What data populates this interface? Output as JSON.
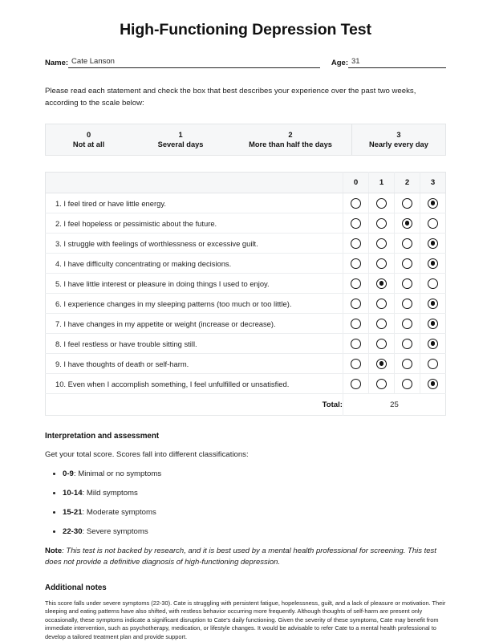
{
  "document": {
    "title": "High-Functioning Depression Test"
  },
  "patient": {
    "name_label": "Name:",
    "name_value": "Cate Lanson",
    "age_label": "Age:",
    "age_value": "31"
  },
  "instructions": {
    "text": "Please read each statement and check the box that best describes your experience over the past two weeks, according to the scale below:"
  },
  "scale": {
    "items": [
      {
        "num": "0",
        "label": "Not at all"
      },
      {
        "num": "1",
        "label": "Several days"
      },
      {
        "num": "2",
        "label": "More than half the days"
      },
      {
        "num": "3",
        "label": "Nearly every day"
      }
    ]
  },
  "questionnaire": {
    "question_header": "",
    "answer_headers": [
      "0",
      "1",
      "2",
      "3"
    ],
    "rows": [
      {
        "text": "1. I feel tired or have little energy.",
        "selected": 3
      },
      {
        "text": "2. I feel hopeless or pessimistic about the future.",
        "selected": 2
      },
      {
        "text": "3. I struggle with feelings of worthlessness or excessive guilt.",
        "selected": 3
      },
      {
        "text": "4. I have difficulty concentrating or making decisions.",
        "selected": 3
      },
      {
        "text": "5. I have little interest or pleasure in doing things I used to enjoy.",
        "selected": 1
      },
      {
        "text": "6. I experience changes in my sleeping patterns (too much or too little).",
        "selected": 3
      },
      {
        "text": "7. I have changes in my appetite or weight (increase or decrease).",
        "selected": 3
      },
      {
        "text": "8. I feel restless or have trouble sitting still.",
        "selected": 3
      },
      {
        "text": "9. I have thoughts of death or self-harm.",
        "selected": 1
      },
      {
        "text": "10. Even when I accomplish something, I feel unfulfilled or unsatisfied.",
        "selected": 3
      }
    ],
    "total_label": "Total:",
    "total_value": "25"
  },
  "interpretation": {
    "heading": "Interpretation and assessment",
    "intro": "Get your total score. Scores fall into different classifications:",
    "bands": [
      {
        "range": "0-9",
        "desc": ": Minimal or no symptoms"
      },
      {
        "range": "10-14",
        "desc": ": Mild symptoms"
      },
      {
        "range": "15-21",
        "desc": ": Moderate symptoms"
      },
      {
        "range": "22-30",
        "desc": ": Severe symptoms"
      }
    ],
    "note_label": "Note",
    "note_text": ": This test is not backed by research, and it is best used by a mental health professional for screening. This test does not provide a definitive diagnosis of high-functioning depression."
  },
  "additional_notes": {
    "heading": "Additional notes",
    "body": "This score falls under severe symptoms (22-30). Cate is struggling with persistent fatigue, hopelessness, guilt, and a lack of pleasure or motivation. Their sleeping and eating patterns have also shifted, with restless behavior occurring more frequently. Although thoughts of self-harm are present only occasionally, these symptoms indicate a significant disruption to Cate's daily functioning. Given the severity of these symptoms, Cate may benefit from immediate intervention, such as psychotherapy, medication, or lifestyle changes. It would be advisable to refer Cate to a mental health professional to develop a tailored treatment plan and provide support."
  }
}
